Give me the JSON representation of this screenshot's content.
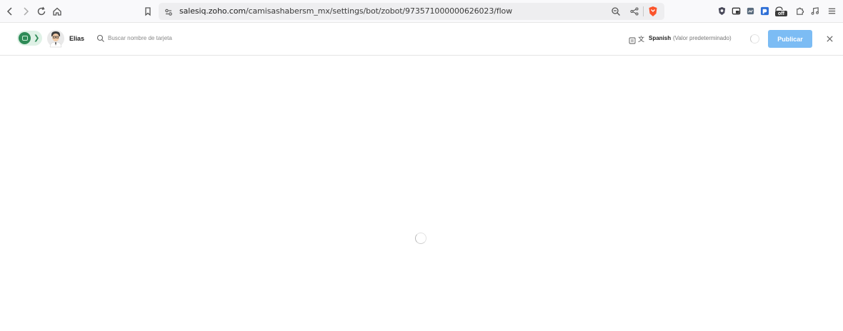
{
  "browser": {
    "url_host": "salesiq.zoho.com",
    "url_path": "/camisashabersm_mx/settings/bot/zobot/973571000000626023/flow",
    "extension_badge": "off"
  },
  "header": {
    "bot_name": "Elias",
    "search_placeholder": "Buscar nombre de tarjeta",
    "language": "Spanish",
    "language_note": "(Valor predeterminado)",
    "publish_label": "Publicar"
  },
  "colors": {
    "accent": "#7cbcf4",
    "status_green": "#2e8b57",
    "brave_orange": "#fb542b"
  },
  "icons": [
    "back-icon",
    "forward-icon",
    "reload-icon",
    "home-icon",
    "bookmark-icon",
    "site-info-icon",
    "zoom-icon",
    "share-icon",
    "brave-shield-icon",
    "search-icon",
    "translate-icon",
    "close-icon",
    "loading-spinner"
  ]
}
